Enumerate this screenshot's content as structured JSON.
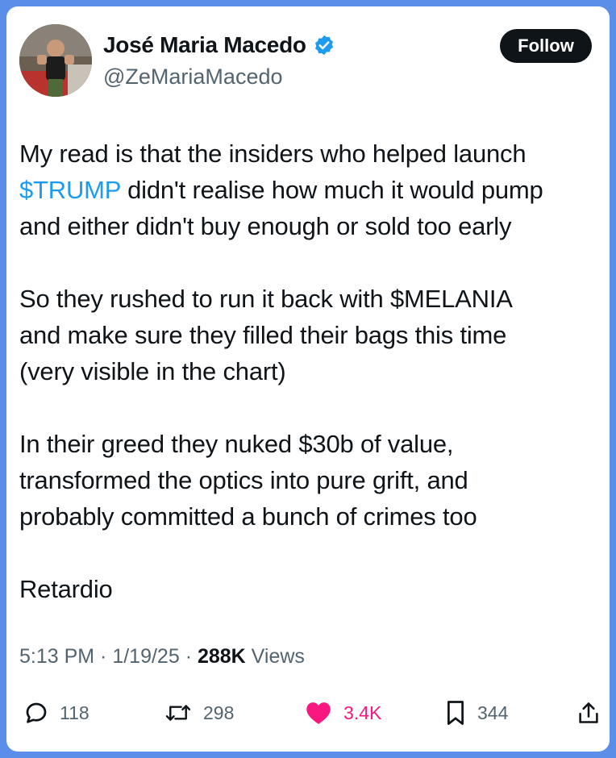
{
  "author": {
    "name": "José Maria Macedo",
    "handle": "@ZeMariaMacedo",
    "verified": true
  },
  "follow_label": "Follow",
  "tweet": {
    "paragraph1": {
      "line1": "My read is that the insiders who helped launch",
      "cashtag": "$TRUMP",
      "line2_rest": " didn't realise how much it would pump",
      "line3": "and either didn't buy enough or sold too early"
    },
    "paragraph2": {
      "line1": "So they rushed to run it back with $MELANIA",
      "line2": "and make sure they filled their bags this time",
      "line3": "(very visible in the chart)"
    },
    "paragraph3": {
      "line1": "In their greed they nuked $30b of value,",
      "line2": "transformed the optics into pure grift, and",
      "line3": "probably committed a bunch of crimes too"
    },
    "paragraph4": {
      "line1": "Retardio"
    }
  },
  "meta": {
    "time": "5:13 PM",
    "separator": " · ",
    "date": "1/19/25",
    "views_count": "288K",
    "views_label": " Views"
  },
  "actions": {
    "replies": "118",
    "reposts": "298",
    "likes": "3.4K",
    "bookmarks": "344"
  },
  "colors": {
    "accent": "#1d9bf0",
    "like": "#f91880",
    "text": "#0f1419",
    "secondary": "#536471",
    "frame": "#5b8ee8"
  },
  "icons": [
    "verified-badge-icon",
    "reply-icon",
    "repost-icon",
    "like-heart-icon",
    "bookmark-icon",
    "share-icon"
  ]
}
